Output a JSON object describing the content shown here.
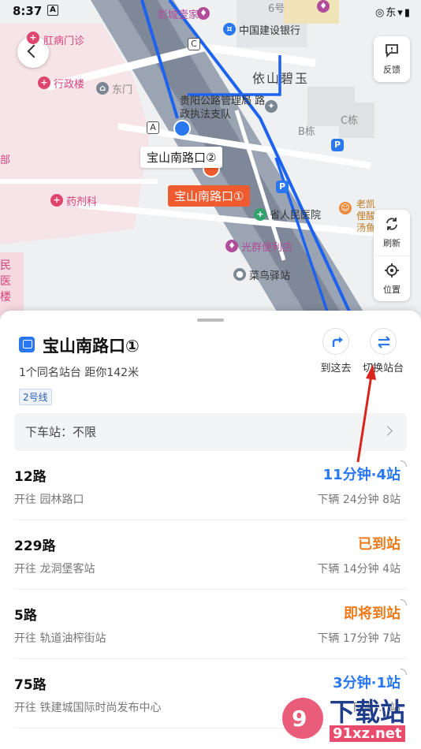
{
  "status_bar": {
    "time": "8:37",
    "a_badge": "A",
    "system_icons": "◎东▾▮"
  },
  "map": {
    "labels": {
      "veteran_clinic": "肛病门诊",
      "admin_building": "行政楼",
      "east_gate": "东门",
      "yingcheng": "影城壹家",
      "construction_bank": "中国建设银行",
      "yishan_biyu": "依山碧玉",
      "law_enforcement": "贵阳公路管理局 路政执法支队",
      "building_b": "B栋",
      "building_c": "C栋",
      "pharmacy": "药剂科",
      "provincial_hospital": "省人民医院",
      "guangxing_store": "光群便利店",
      "cainiao": "菜鸟驿站",
      "laokai": "老凯俚酸汤鱼",
      "bu": "部",
      "min_yi_lou": "民医楼",
      "liu_hao": "6号",
      "a_marker": "A",
      "c_marker": "C"
    },
    "stop_label_2": "宝山南路口②",
    "stop_label_1": "宝山南路口①",
    "side_buttons": {
      "feedback": "反馈",
      "refresh": "刷新",
      "location": "位置"
    }
  },
  "sheet": {
    "stop_name": "宝山南路口①",
    "stop_info": "1个同名站台  距你142米",
    "line_tag": "2号线",
    "go_here": "到这去",
    "switch_platform": "切换站台",
    "alight_label": "下车站：不限",
    "routes": [
      {
        "name": "12路",
        "dest": "开往 园林路口",
        "eta": "11分钟·4站",
        "eta_color": "blue",
        "next": "下辆  24分钟 8站"
      },
      {
        "name": "229路",
        "dest": "开往 龙洞堡客站",
        "eta": "已到站",
        "eta_color": "orange",
        "next": "下辆  14分钟 4站"
      },
      {
        "name": "5路",
        "dest": "开往 轨道油榨街站",
        "eta": "即将到站",
        "eta_color": "orange",
        "next": "下辆  17分钟 7站"
      },
      {
        "name": "75路",
        "dest": "开往 铁建城国际时尚发布中心",
        "eta": "3分钟·1站",
        "eta_color": "blue",
        "next": "下辆  … 站"
      }
    ]
  },
  "watermark": {
    "main": "下载站",
    "sub": "91xz.net"
  },
  "colors": {
    "accent_blue": "#2a78f0",
    "accent_orange": "#f07a1c",
    "stop_red": "#ef5a2e",
    "arrow_red": "#d9261c"
  }
}
